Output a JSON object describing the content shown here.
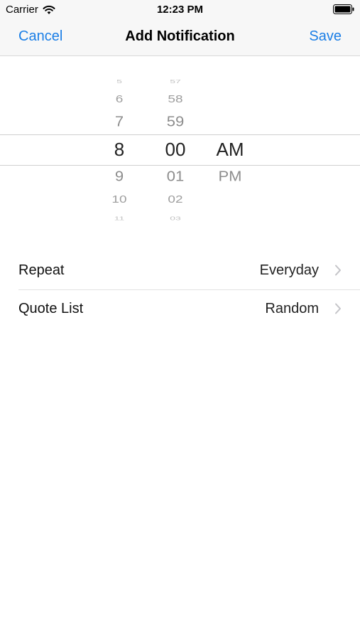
{
  "status_bar": {
    "carrier": "Carrier",
    "time": "12:23 PM"
  },
  "nav": {
    "cancel_label": "Cancel",
    "title": "Add Notification",
    "save_label": "Save"
  },
  "picker": {
    "hour": {
      "options": [
        "5",
        "6",
        "7",
        "8",
        "9",
        "10",
        "11"
      ],
      "selected": "8"
    },
    "minute": {
      "options": [
        "57",
        "58",
        "59",
        "00",
        "01",
        "02",
        "03"
      ],
      "selected": "00"
    },
    "period": {
      "options": [
        "AM",
        "PM"
      ],
      "selected": "AM"
    }
  },
  "settings": {
    "repeat": {
      "label": "Repeat",
      "value": "Everyday"
    },
    "quote_list": {
      "label": "Quote List",
      "value": "Random"
    }
  },
  "colors": {
    "accent": "#1a7ee6",
    "bar_background": "#f7f7f7",
    "picker_unselected": "#8d8d8d"
  }
}
